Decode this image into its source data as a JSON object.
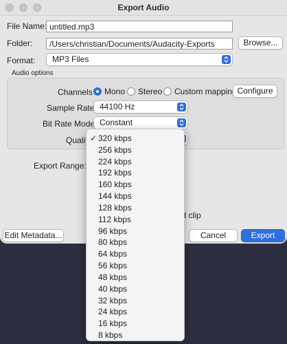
{
  "window": {
    "title": "Export Audio"
  },
  "file": {
    "name_label": "File Name:",
    "name_value": "untitled.mp3",
    "folder_label": "Folder:",
    "folder_value": "/Users/christian/Documents/Audacity-Exports",
    "browse_label": "Browse..."
  },
  "format": {
    "label": "Format:",
    "value": "MP3 Files"
  },
  "audio_options": {
    "header": "Audio options",
    "channels_label": "Channels",
    "channels_options": [
      {
        "label": "Mono",
        "selected": true
      },
      {
        "label": "Stereo",
        "selected": false
      },
      {
        "label": "Custom mapping",
        "selected": false
      }
    ],
    "configure_label": "Configure",
    "sample_rate_label": "Sample Rate",
    "sample_rate_value": "44100 Hz",
    "bit_rate_mode_label": "Bit Rate Mode",
    "bit_rate_mode_value": "Constant",
    "quality_label": "Quality"
  },
  "export_range_label": "Export Range:",
  "partial_text": "t clip",
  "buttons": {
    "edit_metadata": "Edit Metadata...",
    "cancel": "Cancel",
    "export": "Export"
  },
  "quality_menu": {
    "items": [
      "320 kbps",
      "256 kbps",
      "224 kbps",
      "192 kbps",
      "160 kbps",
      "144 kbps",
      "128 kbps",
      "112 kbps",
      "96 kbps",
      "80 kbps",
      "64 kbps",
      "56 kbps",
      "48 kbps",
      "40 kbps",
      "32 kbps",
      "24 kbps",
      "16 kbps",
      "8 kbps"
    ],
    "checked_index": 0,
    "check_mark": "✓"
  },
  "colors": {
    "accent": "#2f6fe0",
    "window_bg": "#e6e6e6",
    "desktop_bg": "#2d2e3f"
  }
}
